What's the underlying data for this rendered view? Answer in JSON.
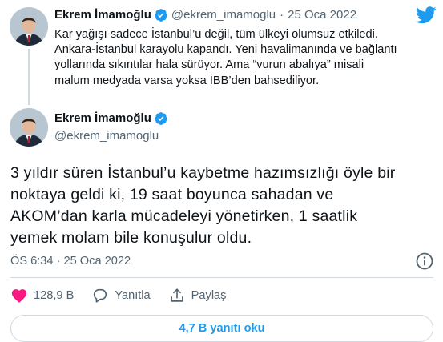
{
  "colors": {
    "accent": "#1d9bf0",
    "text": "#0f1419",
    "muted": "#536471",
    "border": "#cfd9de"
  },
  "reply_tweet": {
    "author_name": "Ekrem İmamoğlu",
    "handle": "@ekrem_imamoglu",
    "separator": "·",
    "date": "25 Oca 2022",
    "lines": [
      "Kar yağışı sadece İstanbul’u değil, tüm ülkeyi olumsuz etkiledi.",
      "Ankara-İstanbul karayolu kapandı. Yeni havalimanında ve bağlantı",
      "yollarında sıkıntılar hala sürüyor. Ama “vurun abalıya” misali",
      "malum medyada varsa yoksa İBB’den bahsediliyor."
    ]
  },
  "main_tweet": {
    "author_name": "Ekrem İmamoğlu",
    "handle": "@ekrem_imamoglu",
    "lines": [
      "3 yıldır süren İstanbul’u kaybetme hazımsızlığı öyle bir",
      "noktaya geldi ki, 19 saat boyunca sahadan ve",
      "AKOM’dan karla mücadeleyi yönetirken, 1 saatlik",
      "yemek molam bile konuşulur oldu."
    ],
    "timestamp": "ÖS 6:34 · 25 Oca 2022"
  },
  "actions": {
    "like_count": "128,9 B",
    "reply_label": "Yanıtla",
    "share_label": "Paylaş"
  },
  "read_replies_label": "4,7 B yanıtı oku",
  "icons": [
    "twitter-logo-icon",
    "verified-badge-icon",
    "info-icon",
    "heart-icon",
    "reply-icon",
    "share-icon"
  ]
}
